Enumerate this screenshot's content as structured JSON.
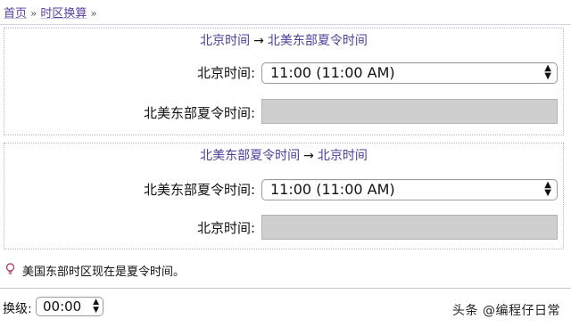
{
  "breadcrumb": {
    "items": [
      "首页",
      "时区换算"
    ],
    "separator": "»"
  },
  "panel1": {
    "title_from": "北京时间",
    "title_arrow": "→",
    "title_to": "北美东部夏令时间",
    "input_label": "北京时间:",
    "input_value": "11:00 (11:00 AM)",
    "output_label": "北美东部夏令时间:",
    "output_value": ""
  },
  "panel2": {
    "title_from": "北美东部夏令时间",
    "title_arrow": "→",
    "title_to": "北京时间",
    "input_label": "北美东部夏令时间:",
    "input_value": "11:00 (11:00 AM)",
    "output_label": "北京时间:",
    "output_value": ""
  },
  "note": {
    "icon": "lightbulb-icon",
    "text": "美国东部时区现在是夏令时间。"
  },
  "zoom": {
    "label": "换级:",
    "value": "00:00"
  },
  "watermark": "头条 @编程仔日常",
  "colors": {
    "link": "#5a3fa0",
    "result_bg": "#cfcfcf",
    "bulb": "#b0467a"
  }
}
